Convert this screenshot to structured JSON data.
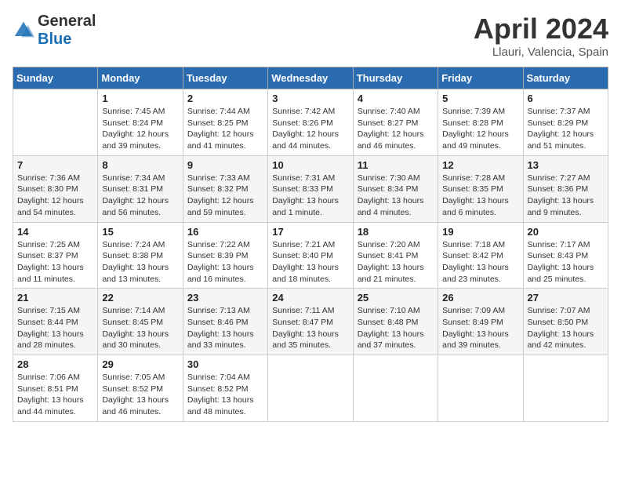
{
  "header": {
    "logo_general": "General",
    "logo_blue": "Blue",
    "month_title": "April 2024",
    "location": "Llauri, Valencia, Spain"
  },
  "days_of_week": [
    "Sunday",
    "Monday",
    "Tuesday",
    "Wednesday",
    "Thursday",
    "Friday",
    "Saturday"
  ],
  "weeks": [
    [
      {
        "day": "",
        "sunrise": "",
        "sunset": "",
        "daylight": ""
      },
      {
        "day": "1",
        "sunrise": "Sunrise: 7:45 AM",
        "sunset": "Sunset: 8:24 PM",
        "daylight": "Daylight: 12 hours and 39 minutes."
      },
      {
        "day": "2",
        "sunrise": "Sunrise: 7:44 AM",
        "sunset": "Sunset: 8:25 PM",
        "daylight": "Daylight: 12 hours and 41 minutes."
      },
      {
        "day": "3",
        "sunrise": "Sunrise: 7:42 AM",
        "sunset": "Sunset: 8:26 PM",
        "daylight": "Daylight: 12 hours and 44 minutes."
      },
      {
        "day": "4",
        "sunrise": "Sunrise: 7:40 AM",
        "sunset": "Sunset: 8:27 PM",
        "daylight": "Daylight: 12 hours and 46 minutes."
      },
      {
        "day": "5",
        "sunrise": "Sunrise: 7:39 AM",
        "sunset": "Sunset: 8:28 PM",
        "daylight": "Daylight: 12 hours and 49 minutes."
      },
      {
        "day": "6",
        "sunrise": "Sunrise: 7:37 AM",
        "sunset": "Sunset: 8:29 PM",
        "daylight": "Daylight: 12 hours and 51 minutes."
      }
    ],
    [
      {
        "day": "7",
        "sunrise": "Sunrise: 7:36 AM",
        "sunset": "Sunset: 8:30 PM",
        "daylight": "Daylight: 12 hours and 54 minutes."
      },
      {
        "day": "8",
        "sunrise": "Sunrise: 7:34 AM",
        "sunset": "Sunset: 8:31 PM",
        "daylight": "Daylight: 12 hours and 56 minutes."
      },
      {
        "day": "9",
        "sunrise": "Sunrise: 7:33 AM",
        "sunset": "Sunset: 8:32 PM",
        "daylight": "Daylight: 12 hours and 59 minutes."
      },
      {
        "day": "10",
        "sunrise": "Sunrise: 7:31 AM",
        "sunset": "Sunset: 8:33 PM",
        "daylight": "Daylight: 13 hours and 1 minute."
      },
      {
        "day": "11",
        "sunrise": "Sunrise: 7:30 AM",
        "sunset": "Sunset: 8:34 PM",
        "daylight": "Daylight: 13 hours and 4 minutes."
      },
      {
        "day": "12",
        "sunrise": "Sunrise: 7:28 AM",
        "sunset": "Sunset: 8:35 PM",
        "daylight": "Daylight: 13 hours and 6 minutes."
      },
      {
        "day": "13",
        "sunrise": "Sunrise: 7:27 AM",
        "sunset": "Sunset: 8:36 PM",
        "daylight": "Daylight: 13 hours and 9 minutes."
      }
    ],
    [
      {
        "day": "14",
        "sunrise": "Sunrise: 7:25 AM",
        "sunset": "Sunset: 8:37 PM",
        "daylight": "Daylight: 13 hours and 11 minutes."
      },
      {
        "day": "15",
        "sunrise": "Sunrise: 7:24 AM",
        "sunset": "Sunset: 8:38 PM",
        "daylight": "Daylight: 13 hours and 13 minutes."
      },
      {
        "day": "16",
        "sunrise": "Sunrise: 7:22 AM",
        "sunset": "Sunset: 8:39 PM",
        "daylight": "Daylight: 13 hours and 16 minutes."
      },
      {
        "day": "17",
        "sunrise": "Sunrise: 7:21 AM",
        "sunset": "Sunset: 8:40 PM",
        "daylight": "Daylight: 13 hours and 18 minutes."
      },
      {
        "day": "18",
        "sunrise": "Sunrise: 7:20 AM",
        "sunset": "Sunset: 8:41 PM",
        "daylight": "Daylight: 13 hours and 21 minutes."
      },
      {
        "day": "19",
        "sunrise": "Sunrise: 7:18 AM",
        "sunset": "Sunset: 8:42 PM",
        "daylight": "Daylight: 13 hours and 23 minutes."
      },
      {
        "day": "20",
        "sunrise": "Sunrise: 7:17 AM",
        "sunset": "Sunset: 8:43 PM",
        "daylight": "Daylight: 13 hours and 25 minutes."
      }
    ],
    [
      {
        "day": "21",
        "sunrise": "Sunrise: 7:15 AM",
        "sunset": "Sunset: 8:44 PM",
        "daylight": "Daylight: 13 hours and 28 minutes."
      },
      {
        "day": "22",
        "sunrise": "Sunrise: 7:14 AM",
        "sunset": "Sunset: 8:45 PM",
        "daylight": "Daylight: 13 hours and 30 minutes."
      },
      {
        "day": "23",
        "sunrise": "Sunrise: 7:13 AM",
        "sunset": "Sunset: 8:46 PM",
        "daylight": "Daylight: 13 hours and 33 minutes."
      },
      {
        "day": "24",
        "sunrise": "Sunrise: 7:11 AM",
        "sunset": "Sunset: 8:47 PM",
        "daylight": "Daylight: 13 hours and 35 minutes."
      },
      {
        "day": "25",
        "sunrise": "Sunrise: 7:10 AM",
        "sunset": "Sunset: 8:48 PM",
        "daylight": "Daylight: 13 hours and 37 minutes."
      },
      {
        "day": "26",
        "sunrise": "Sunrise: 7:09 AM",
        "sunset": "Sunset: 8:49 PM",
        "daylight": "Daylight: 13 hours and 39 minutes."
      },
      {
        "day": "27",
        "sunrise": "Sunrise: 7:07 AM",
        "sunset": "Sunset: 8:50 PM",
        "daylight": "Daylight: 13 hours and 42 minutes."
      }
    ],
    [
      {
        "day": "28",
        "sunrise": "Sunrise: 7:06 AM",
        "sunset": "Sunset: 8:51 PM",
        "daylight": "Daylight: 13 hours and 44 minutes."
      },
      {
        "day": "29",
        "sunrise": "Sunrise: 7:05 AM",
        "sunset": "Sunset: 8:52 PM",
        "daylight": "Daylight: 13 hours and 46 minutes."
      },
      {
        "day": "30",
        "sunrise": "Sunrise: 7:04 AM",
        "sunset": "Sunset: 8:52 PM",
        "daylight": "Daylight: 13 hours and 48 minutes."
      },
      {
        "day": "",
        "sunrise": "",
        "sunset": "",
        "daylight": ""
      },
      {
        "day": "",
        "sunrise": "",
        "sunset": "",
        "daylight": ""
      },
      {
        "day": "",
        "sunrise": "",
        "sunset": "",
        "daylight": ""
      },
      {
        "day": "",
        "sunrise": "",
        "sunset": "",
        "daylight": ""
      }
    ]
  ]
}
